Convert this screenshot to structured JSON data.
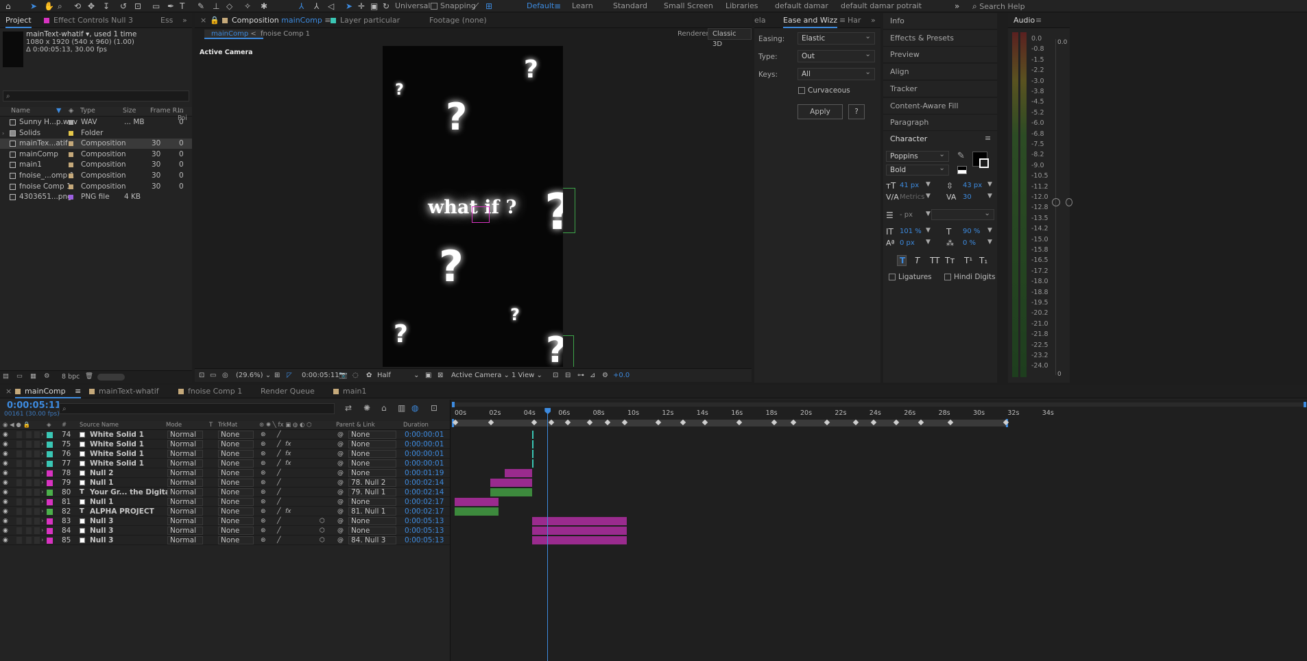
{
  "toolbar": {
    "universal_label": "Universal",
    "snapping_label": "Snapping",
    "workspaces": [
      "Default",
      "Learn",
      "Standard",
      "Small Screen",
      "Libraries",
      "default damar",
      "default damar potrait"
    ],
    "active_workspace": "Default",
    "search_placeholder": "Search Help"
  },
  "project_panel": {
    "tabs": [
      "Project",
      "Effect Controls Null 3",
      "Ess"
    ],
    "selected_name": "mainText-whatif",
    "used_text": ", used 1 time",
    "dims": "1080 x 1920  (540 x 960) (1.00)",
    "duration": "Δ 0:00:05:13, 30.00 fps",
    "columns": [
      "Name",
      "Type",
      "Size",
      "Frame R...",
      "In Poi"
    ],
    "items": [
      {
        "name": "Sunny H...p.wav",
        "type": "WAV",
        "size": "... MB",
        "fr": "",
        "inp": "0",
        "color": "#a7a7a7",
        "icon": "audio-file-icon"
      },
      {
        "name": "Solids",
        "type": "Folder",
        "size": "",
        "fr": "",
        "inp": "",
        "color": "#e6c84a",
        "icon": "folder-icon"
      },
      {
        "name": "mainTex...atif",
        "type": "Composition",
        "size": "",
        "fr": "30",
        "inp": "0",
        "color": "#c5a97a",
        "icon": "composition-icon"
      },
      {
        "name": "mainComp",
        "type": "Composition",
        "size": "",
        "fr": "30",
        "inp": "0",
        "color": "#c5a97a",
        "icon": "composition-icon"
      },
      {
        "name": "main1",
        "type": "Composition",
        "size": "",
        "fr": "30",
        "inp": "0",
        "color": "#c5a97a",
        "icon": "composition-icon"
      },
      {
        "name": "fnoise_...omp 1",
        "type": "Composition",
        "size": "",
        "fr": "30",
        "inp": "0",
        "color": "#c5a97a",
        "icon": "composition-icon"
      },
      {
        "name": "fnoise Comp 1",
        "type": "Composition",
        "size": "",
        "fr": "30",
        "inp": "0",
        "color": "#c5a97a",
        "icon": "composition-icon"
      },
      {
        "name": "4303651...png",
        "type": "PNG file",
        "size": "4 KB",
        "fr": "",
        "inp": "",
        "color": "#9c5fe0",
        "icon": "image-file-icon"
      }
    ],
    "bpc": "8 bpc"
  },
  "comp_panel": {
    "tab_prefix": "Composition",
    "tab_name": "mainComp",
    "layer_tab": "Layer  particular",
    "footage_tab": "Footage (none)",
    "breadcrumbs": [
      "mainComp",
      "fnoise Comp 1"
    ],
    "renderer_label": "Renderer:",
    "renderer_value": "Classic 3D",
    "active_camera": "Active Camera",
    "canvas_text": "what if ?",
    "zoom": "(29.6%)",
    "timecode": "0:00:05:11",
    "resolution": "Half",
    "camera_view": "Active Camera",
    "views": "1 View",
    "exposure": "+0.0"
  },
  "ease_panel": {
    "tabs": [
      "ela",
      "Ease and Wizz",
      "Har"
    ],
    "easing_label": "Easing:",
    "easing_value": "Elastic",
    "type_label": "Type:",
    "type_value": "Out",
    "keys_label": "Keys:",
    "keys_value": "All",
    "curvaceous_label": "Curvaceous",
    "apply_label": "Apply",
    "help_label": "?"
  },
  "info_panel": {
    "items": [
      "Info",
      "Effects & Presets",
      "Preview",
      "Align",
      "Tracker",
      "Content-Aware Fill",
      "Paragraph"
    ],
    "character_title": "Character",
    "font": "Poppins",
    "style": "Bold",
    "font_size": "41 px",
    "leading": "43 px",
    "kerning": "Metrics",
    "tracking": "30",
    "stroke": "- px",
    "vscale": "101 %",
    "hscale": "90 %",
    "baseline": "0 px",
    "tsume": "0 %",
    "style_buttons": [
      "T",
      "T",
      "TT",
      "Tт",
      "T¹",
      "T₁"
    ],
    "ligatures_label": "Ligatures",
    "hindi_label": "Hindi Digits"
  },
  "audio_panel": {
    "title": "Audio",
    "levels": [
      "0.0",
      "-0.8",
      "-1.5",
      "-2.2",
      "-3.0",
      "-3.8",
      "-4.5",
      "-5.2",
      "-6.0",
      "-6.8",
      "-7.5",
      "-8.2",
      "-9.0",
      "-10.5",
      "-11.2",
      "-12.0",
      "-12.8",
      "-13.5",
      "-14.2",
      "-15.0",
      "-15.8",
      "-16.5",
      "-17.2",
      "-18.0",
      "-18.8",
      "-19.5",
      "-20.2",
      "-21.0",
      "-21.8",
      "-22.5",
      "-23.2",
      "-24.0"
    ],
    "right_values": [
      "0.0",
      "0"
    ]
  },
  "timeline": {
    "tabs": [
      "mainComp",
      "mainText-whatif",
      "fnoise Comp 1",
      "Render Queue",
      "main1"
    ],
    "current_time": "0:00:05:11",
    "frame_info": "00161 (30.00 fps)",
    "columns": [
      "#",
      "Source Name",
      "Mode",
      "T",
      "TrkMat",
      "Parent & Link",
      "Duration"
    ],
    "ruler": [
      "00s",
      "02s",
      "04s",
      "06s",
      "08s",
      "10s",
      "12s",
      "14s",
      "16s",
      "18s",
      "20s",
      "22s",
      "24s",
      "26s",
      "28s",
      "30s",
      "32s",
      "34s"
    ],
    "playhead_seconds": 5.37,
    "layers": [
      {
        "num": "74",
        "name": "White Solid 1",
        "mode": "Normal",
        "trk": "None",
        "parent": "None",
        "dur": "0:00:00:01",
        "color": "#3ac6b4",
        "fx": false
      },
      {
        "num": "75",
        "name": "White Solid 1",
        "mode": "Normal",
        "trk": "None",
        "parent": "None",
        "dur": "0:00:00:01",
        "color": "#3ac6b4",
        "fx": true
      },
      {
        "num": "76",
        "name": "White Solid 1",
        "mode": "Normal",
        "trk": "None",
        "parent": "None",
        "dur": "0:00:00:01",
        "color": "#3ac6b4",
        "fx": true
      },
      {
        "num": "77",
        "name": "White Solid 1",
        "mode": "Normal",
        "trk": "None",
        "parent": "None",
        "dur": "0:00:00:01",
        "color": "#3ac6b4",
        "fx": true
      },
      {
        "num": "78",
        "name": "Null 2",
        "mode": "Normal",
        "trk": "None",
        "parent": "None",
        "dur": "0:00:01:19",
        "color": "#d833c1",
        "fx": false
      },
      {
        "num": "79",
        "name": "Null 1",
        "mode": "Normal",
        "trk": "None",
        "parent": "78. Null 2",
        "dur": "0:00:02:14",
        "color": "#d833c1",
        "fx": false
      },
      {
        "num": "80",
        "name": "Your Gr... the Digital Era",
        "mode": "Normal",
        "trk": "None",
        "parent": "79. Null 1",
        "dur": "0:00:02:14",
        "color": "#4bb04b",
        "fx": false
      },
      {
        "num": "81",
        "name": "Null 1",
        "mode": "Normal",
        "trk": "None",
        "parent": "None",
        "dur": "0:00:02:17",
        "color": "#d833c1",
        "fx": false
      },
      {
        "num": "82",
        "name": "ALPHA PROJECT",
        "mode": "Normal",
        "trk": "None",
        "parent": "81. Null 1",
        "dur": "0:00:02:17",
        "color": "#4bb04b",
        "fx": true
      },
      {
        "num": "83",
        "name": "Null 3",
        "mode": "Normal",
        "trk": "None",
        "parent": "None",
        "dur": "0:00:05:13",
        "color": "#d833c1",
        "fx": false
      },
      {
        "num": "84",
        "name": "Null 3",
        "mode": "Normal",
        "trk": "None",
        "parent": "None",
        "dur": "0:00:05:13",
        "color": "#d833c1",
        "fx": false
      },
      {
        "num": "85",
        "name": "Null 3",
        "mode": "Normal",
        "trk": "None",
        "parent": "84. Null 3",
        "dur": "0:00:05:13",
        "color": "#d833c1",
        "fx": false
      }
    ],
    "bars": [
      {
        "start": 4.5,
        "end": 4.55,
        "color": "#3ac6b4"
      },
      {
        "start": 4.5,
        "end": 4.55,
        "color": "#3ac6b4"
      },
      {
        "start": 4.5,
        "end": 4.55,
        "color": "#3ac6b4"
      },
      {
        "start": 4.5,
        "end": 4.55,
        "color": "#3ac6b4"
      },
      {
        "start": 2.9,
        "end": 4.5,
        "color": "#9a2b8e"
      },
      {
        "start": 2.05,
        "end": 4.5,
        "color": "#9a2b8e"
      },
      {
        "start": 2.05,
        "end": 4.5,
        "color": "#3d8a3d"
      },
      {
        "start": 0,
        "end": 2.55,
        "color": "#9a2b8e"
      },
      {
        "start": 0,
        "end": 2.55,
        "color": "#3d8a3d"
      },
      {
        "start": 4.5,
        "end": 9.95,
        "color": "#9a2b8e"
      },
      {
        "start": 4.5,
        "end": 9.95,
        "color": "#9a2b8e"
      },
      {
        "start": 4.5,
        "end": 9.95,
        "color": "#9a2b8e"
      }
    ]
  }
}
